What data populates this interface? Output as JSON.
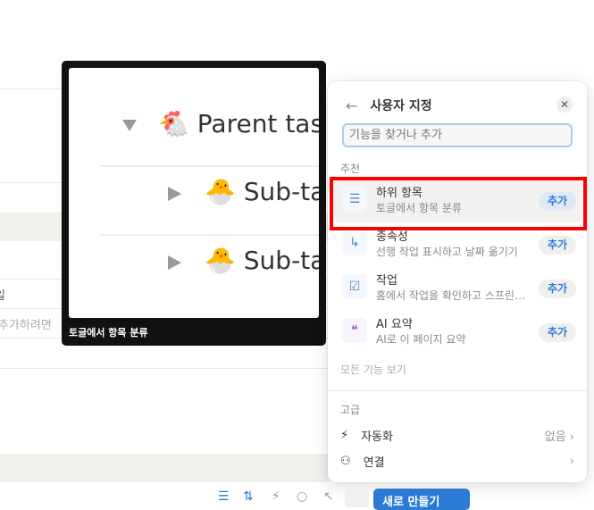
{
  "background": {
    "row_date_text": "일",
    "row_hint_text": "추가하려면 "
  },
  "preview": {
    "caption": "토글에서 항목 분류",
    "parent": "Parent task",
    "parent_emoji": "🐔",
    "sub1": "Sub-task",
    "sub2": "Sub-task",
    "sub_emoji": "🐣"
  },
  "panel": {
    "title": "사용자 지정",
    "search_placeholder": "기능을 찾거나 추가",
    "suggested_label": "추천",
    "items": [
      {
        "title": "하위 항목",
        "desc": "토글에서 항목 분류",
        "add": "추가",
        "icon": "list-indent-icon"
      },
      {
        "title": "종속성",
        "desc": "선행 작업 표시하고 날짜 옮기기",
        "add": "추가",
        "icon": "arrow-turn-icon"
      },
      {
        "title": "작업",
        "desc": "홈에서 작업을 확인하고 스프린트...",
        "add": "추가",
        "icon": "checkbox-icon"
      },
      {
        "title": "AI 요약",
        "desc": "AI로 이 페이지 요약",
        "add": "추가",
        "icon": "quote-icon"
      }
    ],
    "see_all": "모든 기능 보기",
    "advanced_label": "고급",
    "automation": {
      "label": "자동화",
      "value": "없음"
    },
    "connection": {
      "label": "연결"
    }
  },
  "toolbar": {
    "new_label": "새로 만들기"
  },
  "colors": {
    "accent": "#2b7ad6",
    "highlight": "#ff0000"
  }
}
